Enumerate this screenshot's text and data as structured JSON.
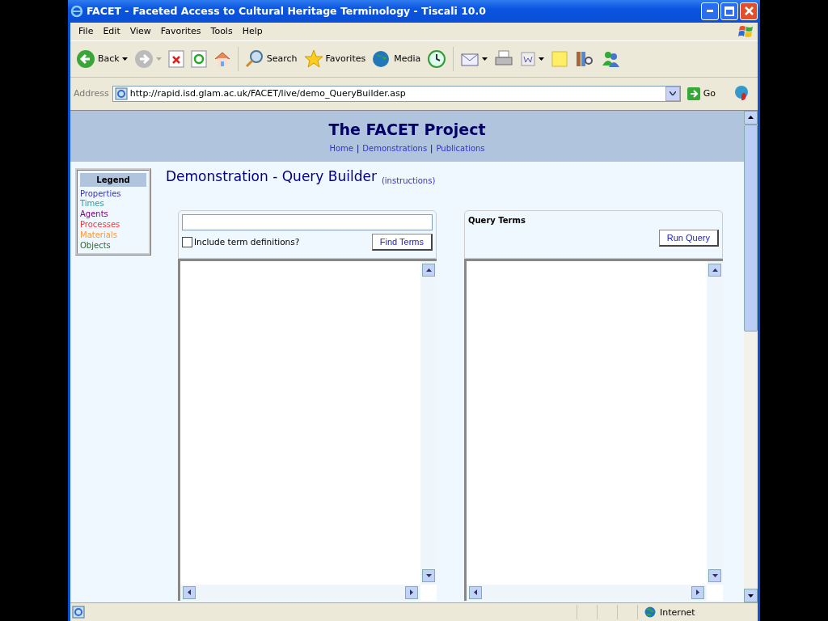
{
  "window": {
    "title": "FACET - Faceted Access to Cultural Heritage Terminology - Tiscali 10.0"
  },
  "menu": [
    "File",
    "Edit",
    "View",
    "Favorites",
    "Tools",
    "Help"
  ],
  "toolbar": {
    "back": "Back",
    "search": "Search",
    "favorites": "Favorites",
    "media": "Media"
  },
  "address_bar": {
    "label": "Address",
    "url": "http://rapid.isd.glam.ac.uk/FACET/live/demo_QueryBuilder.asp",
    "go": "Go"
  },
  "header": {
    "title": "The FACET Project",
    "nav": [
      "Home",
      "Demonstrations",
      "Publications"
    ],
    "separator": "|"
  },
  "legend": {
    "title": "Legend",
    "items": [
      {
        "label": "Properties",
        "color": "#3333cc"
      },
      {
        "label": "Times",
        "color": "#339999"
      },
      {
        "label": "Agents",
        "color": "#800080"
      },
      {
        "label": "Processes",
        "color": "#ff3333"
      },
      {
        "label": "Materials",
        "color": "#ff9933"
      },
      {
        "label": "Objects",
        "color": "#336633"
      }
    ]
  },
  "heading": "Demonstration - Query Builder",
  "instructions_link": "(instructions)",
  "search_panel": {
    "include_definitions": {
      "label": "Include term definitions?",
      "checked": false
    },
    "button": "Find Terms"
  },
  "query_panel": {
    "title": "Query Terms",
    "button": "Run Query"
  },
  "status_bar": {
    "zone": "Internet"
  }
}
